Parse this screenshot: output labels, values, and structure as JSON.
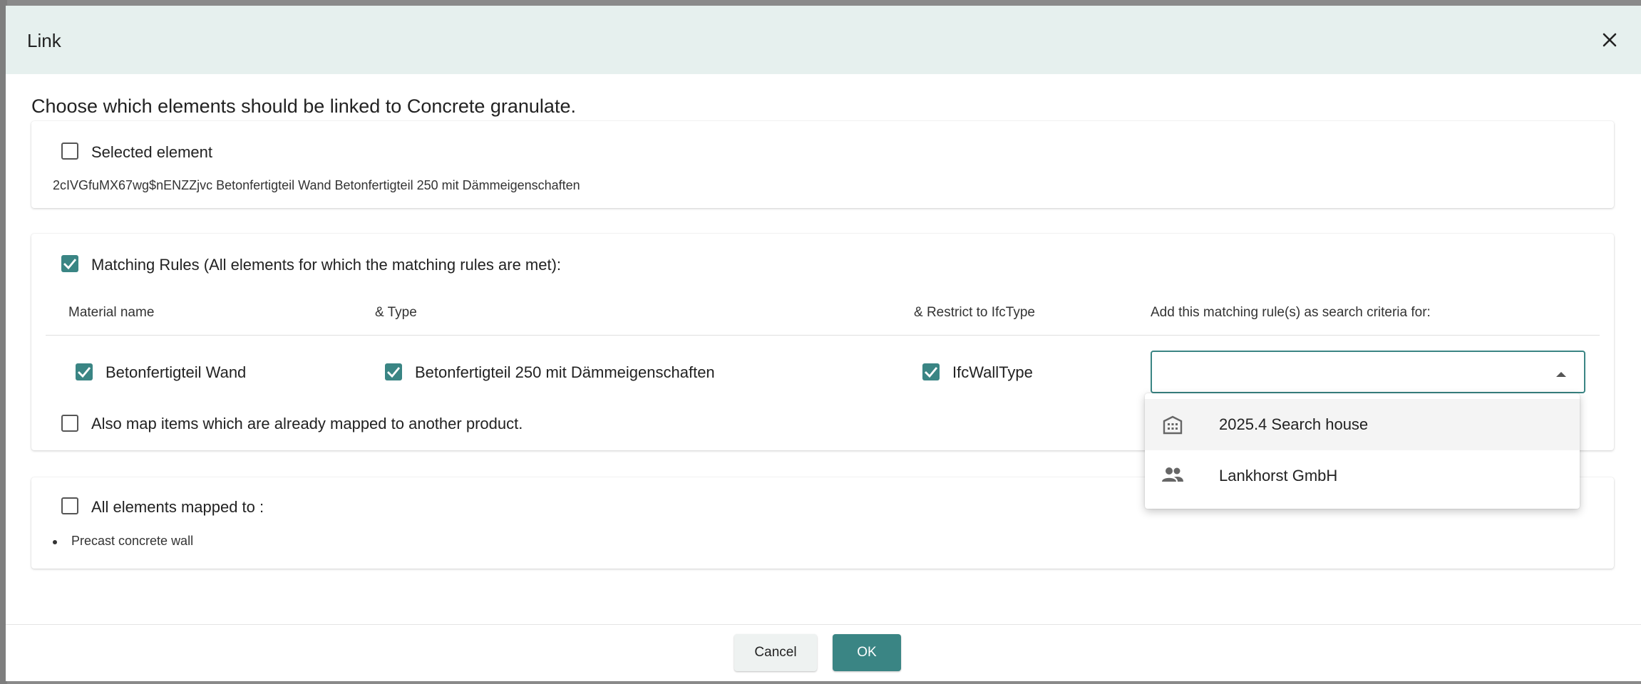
{
  "dialog": {
    "title": "Link",
    "intro": "Choose which elements should be linked to Concrete granulate."
  },
  "selected_element": {
    "label": "Selected element",
    "checked": false,
    "description": "2cIVGfuMX67wg$nENZZjvc Betonfertigteil Wand Betonfertigteil 250 mit Dämmeigenschaften"
  },
  "matching_rules": {
    "label": "Matching Rules (All elements for which the matching rules are met):",
    "checked": true,
    "columns": {
      "material": "Material name",
      "type": "& Type",
      "restrict": "& Restrict to IfcType",
      "search": "Add this matching rule(s) as search criteria for:"
    },
    "row": {
      "material": "Betonfertigteil Wand",
      "type": "Betonfertigteil 250 mit Dämmeigenschaften",
      "ifctype": "IfcWallType"
    },
    "also_map_label": "Also map items which are already mapped to another product.",
    "also_map_checked": false
  },
  "search_dropdown": {
    "value": "",
    "options": [
      {
        "label": "2025.4 Search house",
        "icon": "building-icon"
      },
      {
        "label": "Lankhorst GmbH",
        "icon": "people-icon"
      }
    ]
  },
  "all_mapped": {
    "label": "All elements mapped to :",
    "checked": false,
    "items": [
      "Precast concrete wall"
    ]
  },
  "footer": {
    "cancel": "Cancel",
    "ok": "OK"
  },
  "colors": {
    "accent": "#3a8584",
    "header_bg": "#e6f0ee"
  }
}
